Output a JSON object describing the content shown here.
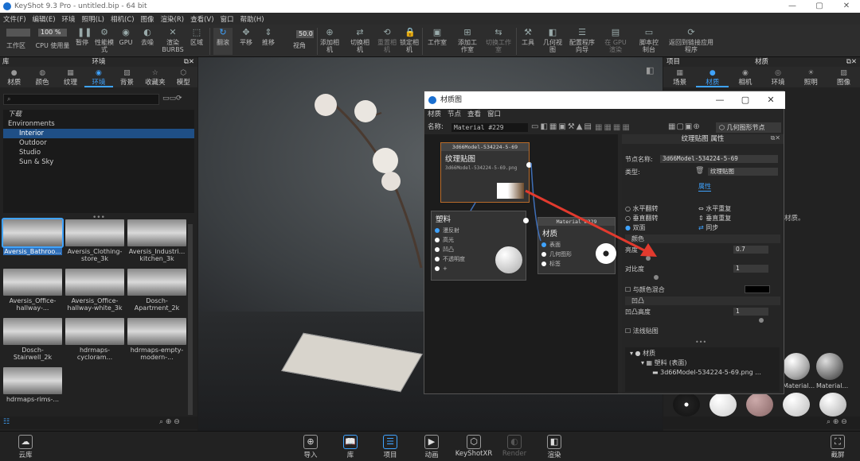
{
  "window": {
    "title": "KeyShot 9.3 Pro - untitled.bip - 64 bit"
  },
  "menu": [
    "文件(F)",
    "编辑(E)",
    "环境",
    "照明(L)",
    "相机(C)",
    "图像",
    "渲染(R)",
    "查看(V)",
    "窗口",
    "帮助(H)"
  ],
  "toolbar": {
    "zoom_value": "100 %",
    "fov_value": "50.0",
    "items": [
      "工作区",
      "CPU 使用量",
      "暂停",
      "性能模式",
      "GPU",
      "去噪",
      "渲染BURBS",
      "区域",
      "翻滚",
      "平移",
      "推移",
      "视角",
      "添加相机",
      "切换相机",
      "重置相机",
      "锁定相机",
      "工作室",
      "添加工作室",
      "切换工作室",
      "工具",
      "几何视图",
      "配置程序向导",
      "在 GPU 渲染",
      "脚本控制台",
      "返回到链接应用程序"
    ]
  },
  "library": {
    "panel_label": "库",
    "title": "环境",
    "tabs": [
      "材质",
      "颜色",
      "纹理",
      "环境",
      "背景",
      "收藏夹",
      "模型"
    ],
    "active_tab": "环境",
    "tree": [
      "下载",
      "Environments",
      "Interior",
      "Outdoor",
      "Studio",
      "Sun & Sky"
    ],
    "selected_tree": "Interior",
    "thumbnails": [
      "Aversis_Bathroo...",
      "Aversis_Clothing-store_3k",
      "Aversis_Industri... kitchen_3k",
      "Aversis_Office-hallway-...",
      "Aversis_Office-hallway-white_3k",
      "Dosch-Apartment_2k",
      "Dosch-Stairwell_2k",
      "hdrmaps-cycloram...",
      "hdrmaps-empty-modern-...",
      "hdrmaps-rims-..."
    ]
  },
  "project": {
    "panel_label": "项目",
    "title": "材质",
    "tabs": [
      "场景",
      "材质",
      "相机",
      "环境",
      "照明",
      "图像"
    ],
    "active_tab": "材质",
    "hint": "材质。",
    "material_labels": [
      "Material...",
      "Material..."
    ]
  },
  "material_window": {
    "title": "材质图",
    "menu": [
      "材质",
      "节点",
      "查看",
      "窗口"
    ],
    "name_label": "名称:",
    "name_value": "Material #229",
    "geometry_node_btn": "几何图形节点",
    "texture_node": {
      "header": "3d66Model-534224-5-69",
      "title": "纹理贴图",
      "file": "3d66Model-534224-5-69.png"
    },
    "plastic_node": {
      "title": "塑料",
      "items": [
        "漫反射",
        "高光",
        "凹凸",
        "不透明度",
        "+"
      ]
    },
    "material_node": {
      "header": "Material #229",
      "title": "材质",
      "items": [
        "表面",
        "几何图形",
        "标签"
      ]
    },
    "props": {
      "title": "纹理贴图 属性",
      "node_name_label": "节点名称:",
      "node_name_value": "3d66Model-534224-5-69",
      "type_label": "类型:",
      "type_value": "纹理贴图",
      "tab": "属性",
      "flip_h": "水平翻转",
      "flip_v": "垂直翻转",
      "repeat_h": "水平重复",
      "repeat_v": "垂直重复",
      "double_side": "双面",
      "sync": "同步",
      "color_section": "颜色",
      "brightness_label": "亮度",
      "brightness_value": "0.7",
      "contrast_label": "对比度",
      "contrast_value": "1",
      "blend_label": "与颜色混合",
      "bump_section": "凹凸",
      "bump_height_label": "凹凸高度",
      "bump_height_value": "1",
      "normal_map_label": "法线贴图",
      "tree": [
        "材质",
        "塑料 (表面)",
        "3d66Model-534224-5-69.png ..."
      ]
    }
  },
  "bottom": {
    "items": [
      "云库",
      "导入",
      "库",
      "项目",
      "动画",
      "KeyShotXR",
      "Render",
      "渲染"
    ],
    "screenshot": "截屏"
  }
}
